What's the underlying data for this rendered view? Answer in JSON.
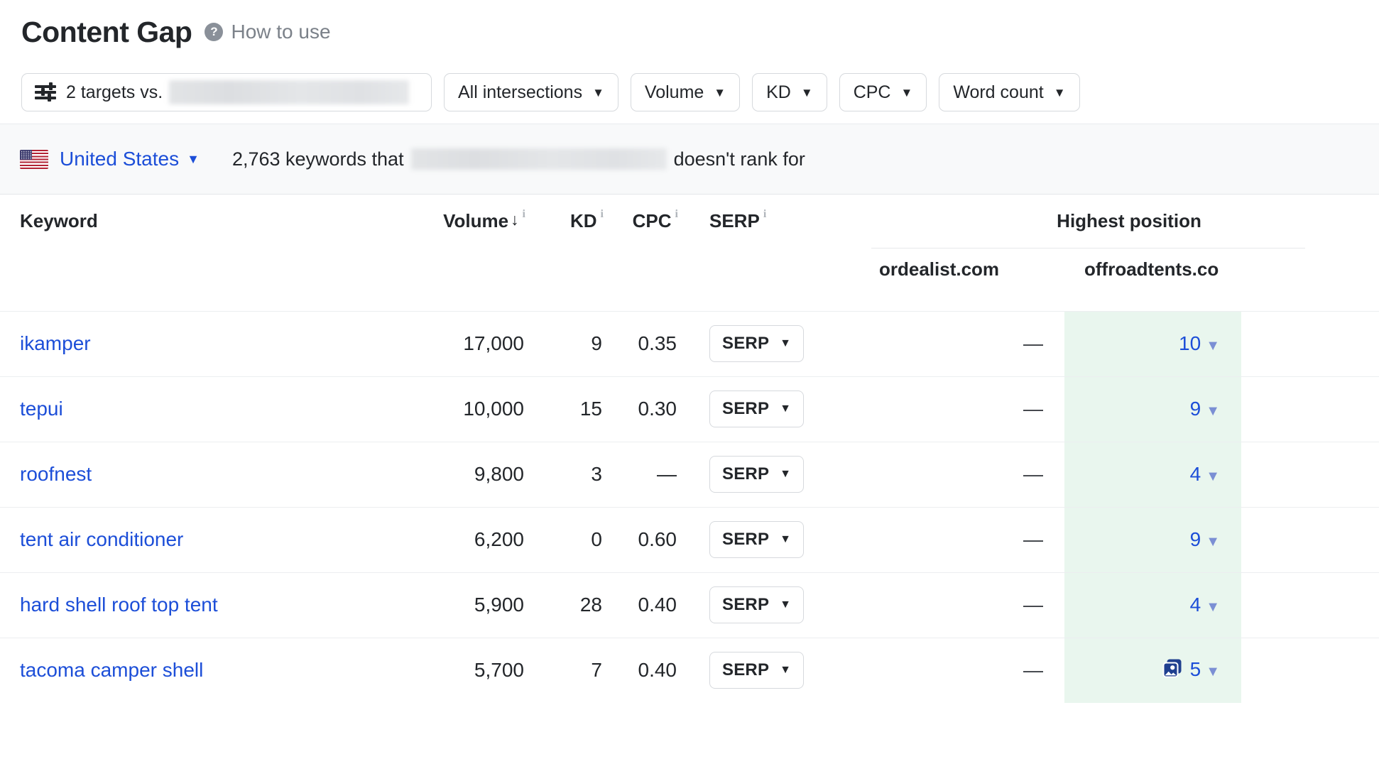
{
  "header": {
    "title": "Content Gap",
    "help_icon": "question-mark-circle-icon",
    "help_link": "How to use"
  },
  "filters": {
    "targets": {
      "icon": "sliders-icon",
      "label": "2 targets vs.",
      "redacted_value": ""
    },
    "intersections": {
      "label": "All intersections",
      "caret": "▼"
    },
    "volume": {
      "label": "Volume",
      "caret": "▼"
    },
    "kd": {
      "label": "KD",
      "caret": "▼"
    },
    "cpc": {
      "label": "CPC",
      "caret": "▼"
    },
    "word_count": {
      "label": "Word count",
      "caret": "▼"
    }
  },
  "country_bar": {
    "flag_icon": "us-flag-icon",
    "country": "United States",
    "caret": "▼",
    "count_prefix": "2,763 keywords that",
    "count_suffix": "doesn't rank for"
  },
  "table": {
    "headers": {
      "keyword": "Keyword",
      "volume": "Volume",
      "volume_sort": "↓",
      "kd": "KD",
      "cpc": "CPC",
      "serp": "SERP",
      "info_marker": "i",
      "group": "Highest position",
      "domain_1": "ordealist.com",
      "domain_2": "offroadtents.co"
    },
    "serp_button_label": "SERP",
    "serp_button_caret": "▼",
    "position_caret": "▼",
    "no_data": "—",
    "rows": [
      {
        "keyword": "ikamper",
        "volume": "17,000",
        "kd": "9",
        "cpc": "0.35",
        "ordealist": "—",
        "offroadtents": "10",
        "offroadtents_feature": null
      },
      {
        "keyword": "tepui",
        "volume": "10,000",
        "kd": "15",
        "cpc": "0.30",
        "ordealist": "—",
        "offroadtents": "9",
        "offroadtents_feature": null
      },
      {
        "keyword": "roofnest",
        "volume": "9,800",
        "kd": "3",
        "cpc": "—",
        "ordealist": "—",
        "offroadtents": "4",
        "offroadtents_feature": null
      },
      {
        "keyword": "tent air conditioner",
        "volume": "6,200",
        "kd": "0",
        "cpc": "0.60",
        "ordealist": "—",
        "offroadtents": "9",
        "offroadtents_feature": null
      },
      {
        "keyword": "hard shell roof top tent",
        "volume": "5,900",
        "kd": "28",
        "cpc": "0.40",
        "ordealist": "—",
        "offroadtents": "4",
        "offroadtents_feature": null
      },
      {
        "keyword": "tacoma camper shell",
        "volume": "5,700",
        "kd": "7",
        "cpc": "0.40",
        "ordealist": "—",
        "offroadtents": "5",
        "offroadtents_feature": "image-pack-icon"
      }
    ]
  },
  "colors": {
    "link_blue": "#1c4ed8",
    "highlight_green": "#e9f6ee",
    "text_dark": "#23262a",
    "muted_grey": "#7b8189",
    "border": "#d6d9dd",
    "feature_icon_blue": "#1f3f8f"
  }
}
